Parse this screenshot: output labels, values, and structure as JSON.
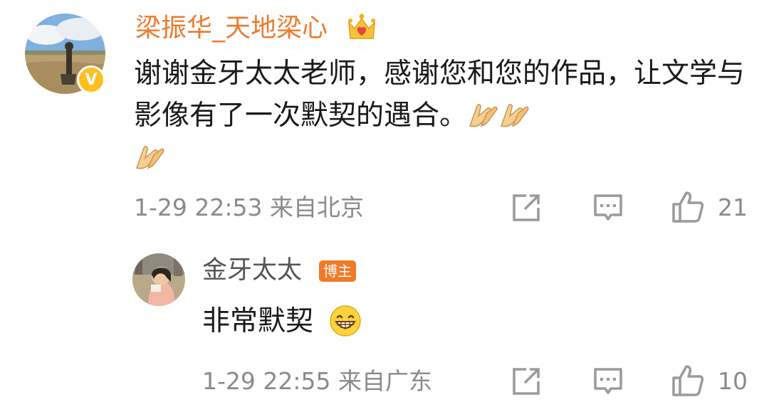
{
  "comment": {
    "author": "梁振华_天地梁心",
    "verified_badge": "V",
    "badge_icon": "crown-heart-icon",
    "text": "谢谢金牙太太老师，感谢您和您的作品，让文学与影像有了一次默契的遇合。",
    "emoji": [
      "clap-hands-icon",
      "clap-hands-icon",
      "clap-hands-icon"
    ],
    "time": "1-29 22:53",
    "source": "来自北京",
    "likes": "21"
  },
  "reply": {
    "author": "金牙太太",
    "owner_badge": "博主",
    "text": "非常默契",
    "emoji": "grinning-face-icon",
    "time": "1-29 22:55",
    "source": "来自广东",
    "likes": "10"
  },
  "colors": {
    "author_name": "#ee7b2d",
    "verified": "#ffc01e",
    "owner_badge": "#f17a28",
    "meta_text": "#8a8a8a",
    "icon": "#9a9a9a"
  }
}
